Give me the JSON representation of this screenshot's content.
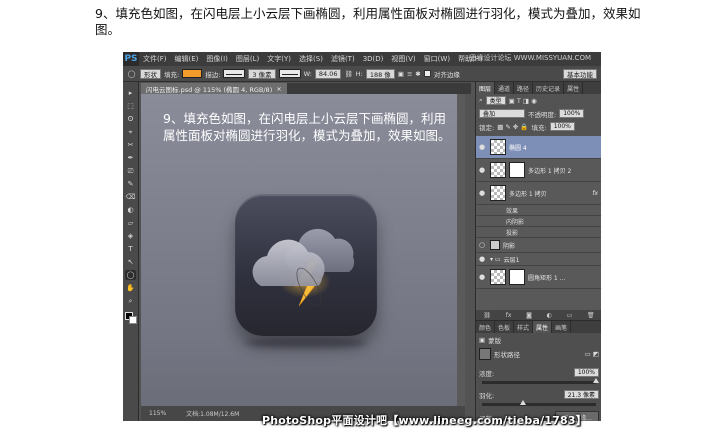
{
  "caption": "9、填充色如图，在闪电层上小云层下画椭圆，利用属性面板对椭圆进行羽化，模式为叠加，效果如图。",
  "app": {
    "logo": "PS",
    "menu": [
      "文件(F)",
      "编辑(E)",
      "图像(I)",
      "图层(L)",
      "文字(Y)",
      "选择(S)",
      "滤镜(T)",
      "3D(D)",
      "视图(V)",
      "窗口(W)",
      "帮助(H)"
    ],
    "watermark": "思缘设计论坛  WWW.MISSYUAN.COM"
  },
  "options": {
    "shape_mode": "形状",
    "fill_label": "填充:",
    "stroke_label": "描边:",
    "stroke_size": "3 像素",
    "width_label": "W:",
    "width_value": "84.06",
    "height_label": "H:",
    "height_value": "188 像",
    "align_edges": "对齐边缘",
    "workspace": "基本功能",
    "fill_color": "#f39c2b"
  },
  "tools": [
    "▸",
    "⬚",
    "ʘ",
    "⌖",
    "✂",
    "✒",
    "⎚",
    "✎",
    "⌫",
    "◐",
    "▱",
    "◈",
    "T",
    "↖",
    "◯",
    "✋",
    "⌕"
  ],
  "document": {
    "tab_label": "闪电云图标.psd @ 115% (椭圆 4, RGB/8)",
    "close": "×",
    "canvas_title": "9、填充色如图，在闪电层上小云层下画椭圆，利用属性面板对椭圆进行羽化，模式为叠加，效果如图。",
    "status_left": "115%",
    "status_right": "文档:1.08M/12.6M"
  },
  "layers_panel": {
    "tabs": [
      "图层",
      "通道",
      "路径",
      "历史记录",
      "属性",
      "调整"
    ],
    "filter_kind": "类型",
    "blend_mode": "叠加",
    "opacity_label": "不透明度:",
    "opacity_value": "100%",
    "lock_label": "锁定:",
    "fill_label": "填充:",
    "fill_value": "100%",
    "layers": [
      {
        "name": "椭圆 4",
        "selected": true
      },
      {
        "name": "多边形 1 拷贝 2",
        "selected": false
      },
      {
        "name": "多边形 1 拷贝",
        "selected": false,
        "fx": "fx"
      },
      {
        "name": "效果",
        "sub": true
      },
      {
        "name": "内阴影",
        "sub": true
      },
      {
        "name": "投影",
        "sub": true
      },
      {
        "name": "阴影",
        "selected": false
      },
      {
        "name": "云层1",
        "selected": false
      },
      {
        "name": "圆角矩形 1 ...",
        "selected": false
      }
    ],
    "bottom_icons": [
      "⛓",
      "fx",
      "◙",
      "◐",
      "▭",
      "🗑"
    ]
  },
  "properties": {
    "tabs": [
      "颜色",
      "色板",
      "样式",
      "属性",
      "画笔"
    ],
    "section": "蒙版",
    "mask_type": "形状路径",
    "density_label": "浓度:",
    "density_value": "100%",
    "density_fraction": 1.0,
    "feather_label": "羽化:",
    "feather_value": "21.3 像素",
    "feather_fraction": 0.36,
    "refine_label": "调整:",
    "refine_button": "蒙版边缘..."
  },
  "footer": "PhotoShop平面设计吧【www.lineeg.com/tieba/1783】"
}
